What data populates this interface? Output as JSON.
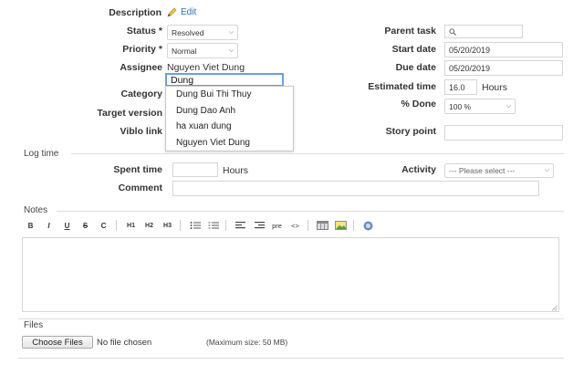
{
  "description": {
    "label": "Description",
    "edit_label": "Edit"
  },
  "fields_left": {
    "status": {
      "label": "Status *",
      "value": "Resolved"
    },
    "priority": {
      "label": "Priority *",
      "value": "Normal"
    },
    "assignee": {
      "label": "Assignee",
      "value": "Nguyen Viet Dung",
      "search_value": "Dung"
    },
    "category": {
      "label": "Category"
    },
    "target_version": {
      "label": "Target version"
    },
    "viblo_link": {
      "label": "Viblo link"
    }
  },
  "assignee_options": [
    "Dung Bui Thi Thuy",
    "Dung Dao Anh",
    "ha xuan dung",
    "Nguyen Viet Dung"
  ],
  "fields_right": {
    "parent_task": {
      "label": "Parent task"
    },
    "start_date": {
      "label": "Start date",
      "value": "05/20/2019"
    },
    "due_date": {
      "label": "Due date",
      "value": "05/20/2019"
    },
    "estimated_time": {
      "label": "Estimated time",
      "value": "16.0",
      "unit": "Hours"
    },
    "done": {
      "label": "% Done",
      "value": "100 %"
    },
    "story_point": {
      "label": "Story point"
    }
  },
  "log_time": {
    "title": "Log time",
    "spent_time": {
      "label": "Spent time",
      "unit": "Hours"
    },
    "activity": {
      "label": "Activity",
      "value": "--- Please select ---"
    },
    "comment": {
      "label": "Comment"
    }
  },
  "notes": {
    "title": "Notes",
    "toolbar": {
      "bold": "B",
      "italic": "I",
      "underline": "U",
      "strike": "S",
      "code": "C",
      "h1": "H1",
      "h2": "H2",
      "h3": "H3",
      "pre": "pre",
      "link": "<>"
    }
  },
  "files": {
    "title": "Files",
    "choose_label": "Choose Files",
    "no_file": "No file chosen",
    "max_size": "(Maximum size: 50 MB)"
  }
}
